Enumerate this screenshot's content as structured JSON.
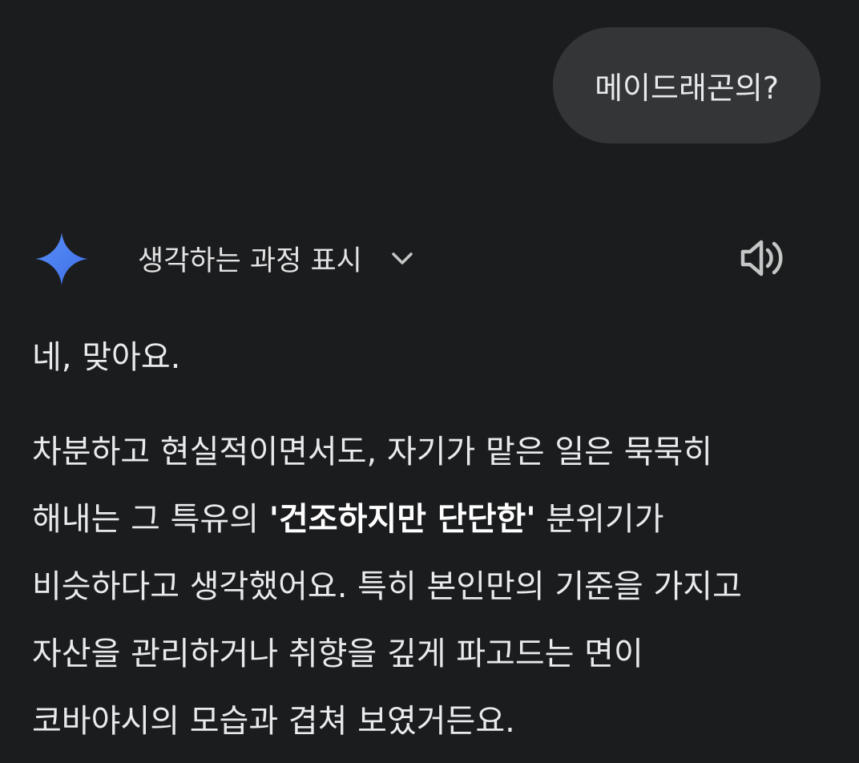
{
  "user_message": {
    "text": "메이드래곤의?"
  },
  "response": {
    "assistant_icon": "gemini-sparkle-icon",
    "thinking_toggle_label": "생각하는 과정 표시",
    "chevron_icon": "chevron-down-icon",
    "speaker_icon": "speaker-icon",
    "paragraph_1": "네, 맞아요.",
    "paragraph_2": {
      "line_1": "차분하고 현실적이면서도, 자기가 맡은 일은 묵묵히",
      "line_2_before": "해내는 그 특유의 ",
      "line_2_bold": "'건조하지만 단단한'",
      "line_2_after": " 분위기가",
      "line_3": "비슷하다고 생각했어요. 특히 본인만의 기준을 가지고",
      "line_4": "자산을 관리하거나 취향을 깊게 파고드는 면이",
      "line_5": "코바야시의 모습과 겹쳐 보였거든요."
    }
  },
  "colors": {
    "background": "#1b1c1e",
    "user_bubble": "#333537",
    "text": "#e8eaed",
    "icon_gray": "#c4c7c5",
    "gemini_blue": "#4c8df6"
  }
}
